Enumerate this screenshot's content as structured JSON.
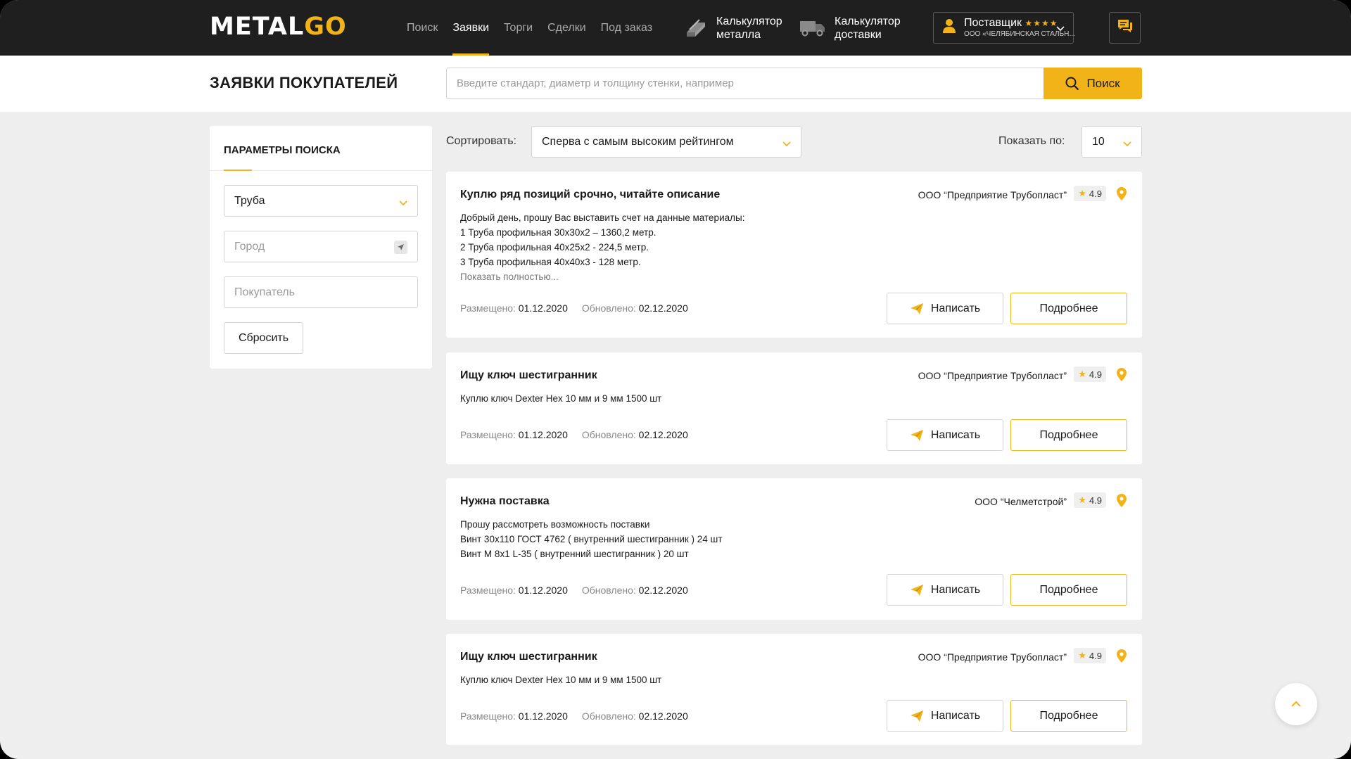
{
  "header": {
    "logo_part1": "METAL",
    "logo_part2": "GO",
    "nav": [
      {
        "label": "Поиск",
        "active": false
      },
      {
        "label": "Заявки",
        "active": true
      },
      {
        "label": "Торги",
        "active": false
      },
      {
        "label": "Сделки",
        "active": false
      },
      {
        "label": "Под заказ",
        "active": false
      }
    ],
    "calc_metal": {
      "line1": "Калькулятор",
      "line2": "металла",
      "icon": "metal-profile-icon"
    },
    "calc_delivery": {
      "line1": "Калькулятор",
      "line2": "доставки",
      "icon": "truck-icon"
    },
    "user": {
      "role": "Поставщик",
      "stars": "★★★★",
      "org": "ООО «ЧЕЛЯБИНСКАЯ СТАЛЬН..."
    },
    "chat_icon": "chat-icon"
  },
  "page": {
    "title": "ЗАЯВКИ ПОКУПАТЕЛЕЙ",
    "search_placeholder": "Введите стандарт, диаметр и толщину стенки, например",
    "search_button": "Поиск"
  },
  "sidebar": {
    "title": "ПАРАМЕТРЫ ПОИСКА",
    "category_value": "Труба",
    "city_placeholder": "Город",
    "buyer_placeholder": "Покупатель",
    "reset_label": "Сбросить"
  },
  "sort": {
    "label": "Сортировать:",
    "value": "Сперва с самым высоким рейтингом",
    "show_label": "Показать по:",
    "show_value": "10"
  },
  "labels": {
    "placed": "Размещено:",
    "updated": "Обновлено:",
    "write": "Написать",
    "details": "Подробнее"
  },
  "requests": [
    {
      "title": "Куплю ряд позиций срочно, читайте описание",
      "company": "ООО “Предприятие Трубопласт”",
      "rating": "4.9",
      "lines": [
        "Добрый день, прошу Вас выставить счет на данные материалы:",
        "1 Труба профильная 30х30х2 – 1360,2 метр.",
        "2 Труба профильная 40х25х2 - 224,5 метр.",
        "3 Труба профильная 40х40х3 - 128 метр."
      ],
      "show_more": "Показать полностью...",
      "placed": "01.12.2020",
      "updated": "02.12.2020"
    },
    {
      "title": "Ищу ключ шестигранник",
      "company": "ООО “Предприятие Трубопласт”",
      "rating": "4.9",
      "lines": [
        "Куплю ключ Dexter Hex 10 мм и 9 мм 1500 шт"
      ],
      "placed": "01.12.2020",
      "updated": "02.12.2020"
    },
    {
      "title": "Нужна поставка",
      "company": "ООО “Челметстрой”",
      "rating": "4.9",
      "lines": [
        "Прошу рассмотреть возможность поставки",
        "Винт 30х110 ГОСТ 4762 ( внутренний шестигранник ) 24 шт",
        "Винт М 8х1 L-35 ( внутренний шестигранник ) 20 шт"
      ],
      "placed": "01.12.2020",
      "updated": "02.12.2020"
    },
    {
      "title": "Ищу ключ шестигранник",
      "company": "ООО “Предприятие Трубопласт”",
      "rating": "4.9",
      "lines": [
        "Куплю ключ Dexter Hex 10 мм и 9 мм 1500 шт"
      ],
      "placed": "01.12.2020",
      "updated": "02.12.2020"
    }
  ],
  "colors": {
    "accent": "#f2b318",
    "header_bg": "#1f1f1f",
    "page_bg": "#eeeeee"
  }
}
